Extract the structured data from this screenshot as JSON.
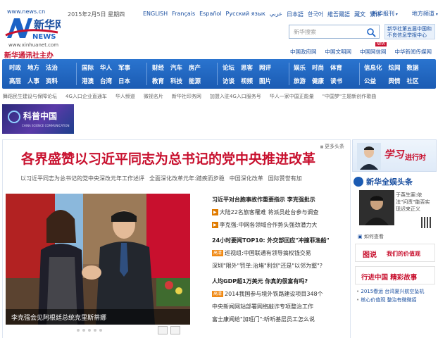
{
  "header": {
    "logo_url": "www.news.cn",
    "logo_sub_url": "www.xinhuanet.com",
    "logo_agency": "新华通讯社主办",
    "date": "2015年2月5日 星期四",
    "languages": [
      "ENGLISH",
      "Français",
      "Español",
      "Русский язык",
      "عربي",
      "日本語",
      "한국어",
      "維吾爾語",
      "藏文",
      "繁体"
    ],
    "app_link": "新华报刊",
    "region_link": "地方频道",
    "search_placeholder": "新华搜索",
    "promo_text": "新华社第五届中国和不良信息举报中心",
    "new_badge": "NEW",
    "sub_links": [
      "中国政府网",
      "中国文明网",
      "中国网信网",
      "中华新闻传媒网"
    ]
  },
  "nav": {
    "groups": [
      [
        "时政",
        "地方",
        "法治",
        "高层",
        "人事",
        "资料"
      ],
      [
        "国际",
        "华人",
        "军事",
        "港澳",
        "台湾",
        "日本"
      ],
      [
        "财经",
        "汽车",
        "房产",
        "教育",
        "科技",
        "能源"
      ],
      [
        "论坛",
        "思客",
        "网评",
        "访谈",
        "视频",
        "图片"
      ],
      [
        "娱乐",
        "时尚",
        "体育",
        "旅游",
        "健康",
        "读书"
      ],
      [
        "信息化",
        "炫闻",
        "数据",
        "公益",
        "舆情",
        "社区"
      ]
    ]
  },
  "ticker": [
    "舞蹈民生建设与保障论坛",
    "4G入口企业直通车",
    "华人频道",
    "微视名片",
    "新华社印务网",
    "加盟入驻4G入口服务号",
    "华人一家中国正能量",
    "\"中国梦\"主题新创作歌曲"
  ],
  "kepu": {
    "title": "科普中国",
    "subtitle": "CHINA SCIENCE COMMUNICATION"
  },
  "main": {
    "more": "更多头条",
    "headline": "各界盛赞以习近平同志为总书记的党中央推进改革",
    "sublinks": [
      "以习近平同志为总书记的党中央深改元年工作述评",
      "全面深化改革元年:踏疾而步稳",
      "中国深化改革",
      "国际赞誉有加"
    ],
    "photo_caption": "李克强会见阿根廷总统克里斯蒂娜",
    "list": [
      {
        "text": "习近平对台胞事故作重要指示 李克强批示",
        "bold": true,
        "tag": ""
      },
      {
        "text": "大陆22名旅客罹难 将派员赴台参与调查",
        "bold": false,
        "tag": "icon"
      },
      {
        "text": "李克强:中网各领域合作势头强劲潜力大",
        "bold": false,
        "tag": "icon"
      },
      {
        "text": "24小时要闻TOP10: 外交部回应\"冲撞菲渔船\"",
        "bold": true,
        "tag": ""
      },
      {
        "text": "巡视组:中国联通有领导搞权钱交易",
        "bold": false,
        "tag": "高清"
      },
      {
        "text": "深圳\"限外\"罚单:治堵\"利剑\"还是\"以邻为壑\"?",
        "bold": false,
        "tag": ""
      },
      {
        "text": "人均GDP超1万美元 你真的很富有吗?",
        "bold": true,
        "tag": ""
      },
      {
        "text": "2014我国参与境外铁路建设项目348个",
        "bold": false,
        "tag": "高清"
      },
      {
        "text": "中央新闻网站部署网络敲诈专项整治工作",
        "bold": false,
        "tag": ""
      },
      {
        "text": "富士康闻给\"加班门\":听听基层员工怎么说",
        "bold": false,
        "tag": ""
      }
    ]
  },
  "right": {
    "banner_a": "学习",
    "banner_b": "进行时",
    "section_title": "新华全娱头条",
    "snippet": "于英生案:依法\"问责\"能否实现迟来正义",
    "question": "如何查看",
    "box1_a": "图说",
    "box1_b": "我们的价值观",
    "box2": "行进中国 精彩故事",
    "links": [
      "2015春运 台湾夏兴航空坠机",
      "核心价值观 整治有微微招"
    ]
  }
}
